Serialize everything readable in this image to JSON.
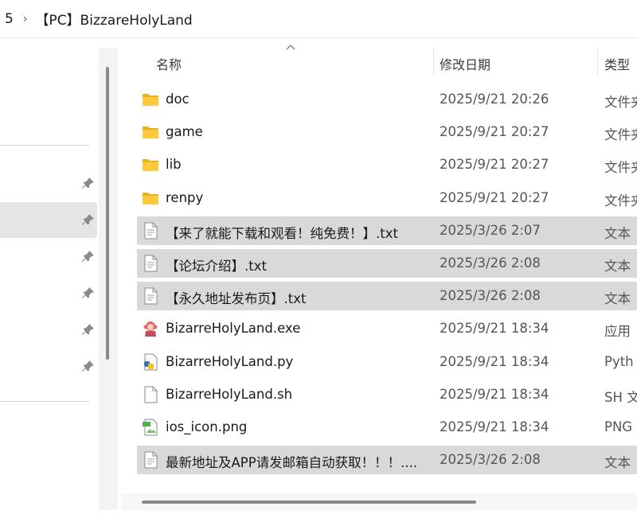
{
  "breadcrumb": {
    "prev": "5",
    "separator": "›",
    "current": "【PC】BizzareHolyLand"
  },
  "columns": {
    "name": "名称",
    "date": "修改日期",
    "type": "类型"
  },
  "sort": {
    "column": "name",
    "icon": "chevron-up-icon"
  },
  "files": [
    {
      "name": "doc",
      "date": "2025/9/21 20:26",
      "type": "文件夹",
      "icon": "folder-icon",
      "selected": false
    },
    {
      "name": "game",
      "date": "2025/9/21 20:27",
      "type": "文件夹",
      "icon": "folder-icon",
      "selected": false
    },
    {
      "name": "lib",
      "date": "2025/9/21 20:27",
      "type": "文件夹",
      "icon": "folder-icon",
      "selected": false
    },
    {
      "name": "renpy",
      "date": "2025/9/21 20:27",
      "type": "文件夹",
      "icon": "folder-icon",
      "selected": false
    },
    {
      "name": "【来了就能下载和观看！纯免费！】.txt",
      "date": "2025/3/26 2:07",
      "type": "文本",
      "icon": "text-file-icon",
      "selected": true
    },
    {
      "name": "【论坛介绍】.txt",
      "date": "2025/3/26 2:08",
      "type": "文本",
      "icon": "text-file-icon",
      "selected": true
    },
    {
      "name": "【永久地址发布页】.txt",
      "date": "2025/3/26 2:08",
      "type": "文本",
      "icon": "text-file-icon",
      "selected": true
    },
    {
      "name": "BizarreHolyLand.exe",
      "date": "2025/9/21 18:34",
      "type": "应用",
      "icon": "app-exe-icon",
      "selected": false
    },
    {
      "name": "BizarreHolyLand.py",
      "date": "2025/9/21 18:34",
      "type": "Pyth",
      "icon": "python-file-icon",
      "selected": false
    },
    {
      "name": "BizarreHolyLand.sh",
      "date": "2025/9/21 18:34",
      "type": "SH 文",
      "icon": "blank-file-icon",
      "selected": false
    },
    {
      "name": "ios_icon.png",
      "date": "2025/9/21 18:34",
      "type": "PNG",
      "icon": "image-file-icon",
      "selected": false
    },
    {
      "name": "最新地址及APP请发邮箱自动获取！！！....",
      "date": "2025/3/26 2:08",
      "type": "文本",
      "icon": "text-file-icon",
      "selected": true
    }
  ]
}
